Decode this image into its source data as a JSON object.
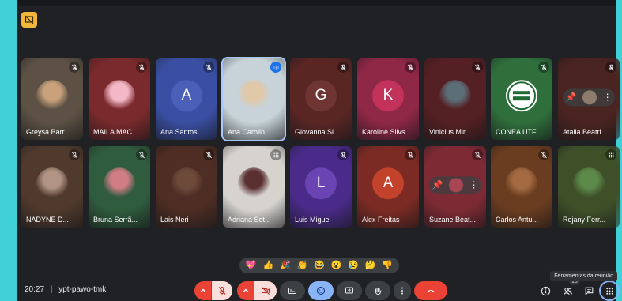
{
  "meeting": {
    "time": "20:27",
    "code": "ypt-pawo-tmk",
    "tooltip": "Ferramentas da reunião",
    "people_count": "18"
  },
  "participants": [
    {
      "name": "Greysa Barr...",
      "type": "photo",
      "bg": "#5c5144",
      "ring": "#c9a27c",
      "mic": "muted"
    },
    {
      "name": "MAILA MAC...",
      "type": "photo",
      "bg": "#7a2a2c",
      "ring": "#f3b8c8",
      "mic": "muted"
    },
    {
      "name": "Ana Santos",
      "type": "letter",
      "letter": "A",
      "bg": "#3a4fa3",
      "circle": "#4a5fb8",
      "mic": "muted"
    },
    {
      "name": "Ana Carolin...",
      "type": "photo",
      "bg": "#c7d3d9",
      "ring": "#e0c8a9",
      "mic": "speaking"
    },
    {
      "name": "Giovanna Si...",
      "type": "letter",
      "letter": "G",
      "bg": "#5a2624",
      "circle": "#6e3532",
      "mic": "muted"
    },
    {
      "name": "Karoline Silvs",
      "type": "letter",
      "letter": "K",
      "bg": "#8f2747",
      "circle": "#c2325b",
      "mic": "muted"
    },
    {
      "name": "Vinicius Mir...",
      "type": "photo",
      "bg": "#552023",
      "ring": "#5c6e78",
      "mic": "muted"
    },
    {
      "name": "CONEA UTF...",
      "type": "logo",
      "bg": "#2f6f3c",
      "ring": "#ffffff",
      "mic": "muted"
    },
    {
      "name": "Atalia Beatri...",
      "type": "pill",
      "bg": "#4a2420",
      "ring": "#8d7c6d",
      "mic": "muted"
    },
    {
      "name": "NADYNE D...",
      "type": "photo",
      "bg": "#503a2d",
      "ring": "#b19484",
      "mic": "muted"
    },
    {
      "name": "Bruna Serrã...",
      "type": "photo",
      "bg": "#2f5c3d",
      "ring": "#d07d86",
      "mic": "muted"
    },
    {
      "name": "Lais Neri",
      "type": "photo",
      "bg": "#4d2d24",
      "ring": "#6e4a3a",
      "mic": "muted"
    },
    {
      "name": "Adriana Sot...",
      "type": "photo",
      "bg": "#d6d3cf",
      "ring": "#5a3030",
      "mic": "none"
    },
    {
      "name": "Luis Miguel",
      "type": "letter",
      "letter": "L",
      "bg": "#4a2b8a",
      "circle": "#6a44b3",
      "mic": "muted"
    },
    {
      "name": "Alex Freitas",
      "type": "letter",
      "letter": "A",
      "bg": "#7c2b24",
      "circle": "#c2422c",
      "mic": "muted"
    },
    {
      "name": "Suzane Beat...",
      "type": "pill",
      "bg": "#7e2a34",
      "ring": "#a74653",
      "mic": "muted"
    },
    {
      "name": "Carlos Antu...",
      "type": "photo",
      "bg": "#6b3d20",
      "ring": "#a46b43",
      "mic": "muted"
    },
    {
      "name": "Rejany Ferr...",
      "type": "photo",
      "bg": "#3f5029",
      "ring": "#5c8a4a",
      "mic": "none"
    }
  ],
  "reactions": [
    "💖",
    "👍",
    "🎉",
    "👏",
    "😂",
    "😮",
    "😢",
    "🤔",
    "👎"
  ],
  "colors": {
    "muted_red": "#ea4335",
    "accent_blue": "#8ab4f8",
    "bar_grey": "#3c4043"
  }
}
